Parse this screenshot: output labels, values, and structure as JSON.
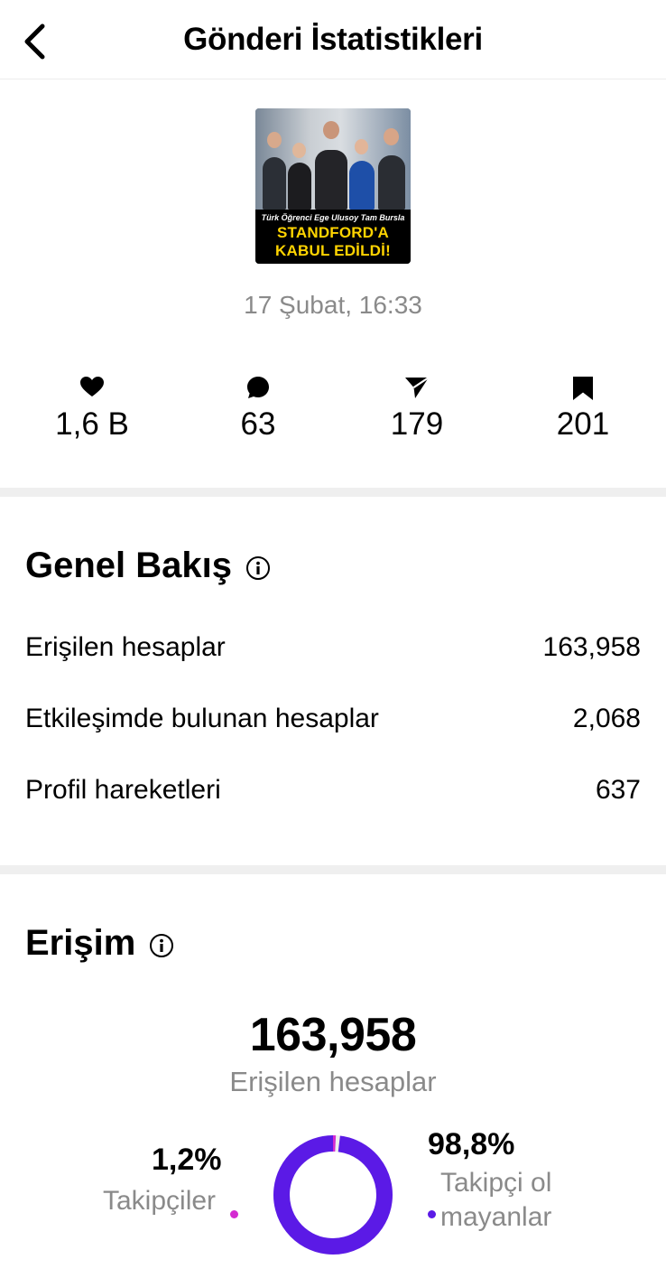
{
  "header": {
    "title": "Gönderi İstatistikleri"
  },
  "post": {
    "thumbnail_caption_small": "Türk Öğrenci Ege Ulusoy Tam Bursla",
    "thumbnail_caption_line1": "STANDFORD'A",
    "thumbnail_caption_line2": "KABUL EDİLDİ!",
    "date": "17 Şubat, 16:33"
  },
  "stats": {
    "likes": "1,6 B",
    "comments": "63",
    "shares": "179",
    "saves": "201"
  },
  "overview": {
    "title": "Genel Bakış",
    "rows": [
      {
        "label": "Erişilen hesaplar",
        "value": "163,958"
      },
      {
        "label": "Etkileşimde bulunan hesaplar",
        "value": "2,068"
      },
      {
        "label": "Profil hareketleri",
        "value": "637"
      }
    ]
  },
  "reach": {
    "title": "Erişim",
    "total": "163,958",
    "total_label": "Erişilen hesaplar",
    "followers_percent": "1,2%",
    "followers_label": "Takipçiler",
    "non_followers_percent": "98,8%",
    "non_followers_label": "Takipçi olmayanlar",
    "followers_fraction": 0.012,
    "non_followers_fraction": 0.988
  },
  "colors": {
    "followers": "#d42bd1",
    "non_followers": "#5b1ae6",
    "muted_text": "#8a8a8a",
    "separator": "#efefef"
  },
  "icons": {
    "back": "chevron-left-icon",
    "likes": "heart-icon",
    "comments": "comment-bubble-icon",
    "shares": "paper-plane-icon",
    "saves": "bookmark-icon",
    "info": "info-circle-icon"
  }
}
